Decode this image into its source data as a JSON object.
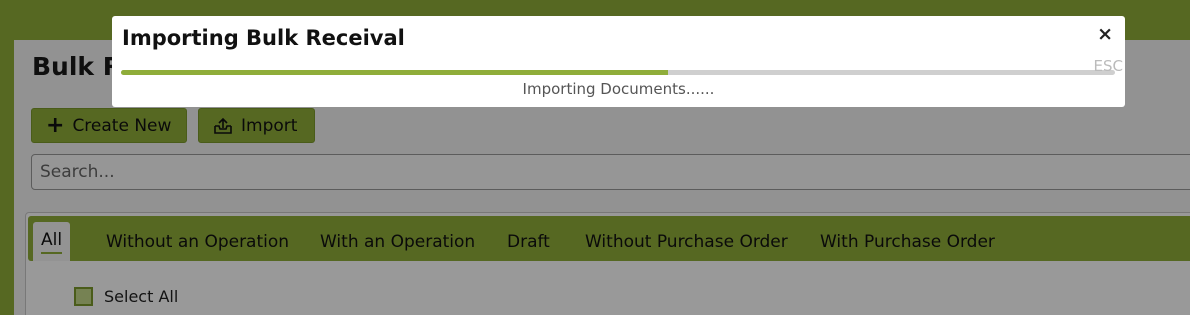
{
  "page": {
    "title": "Bulk R",
    "create_label": "Create New",
    "import_label": "Import",
    "search_placeholder": "Search...",
    "tabs": [
      {
        "label": "All",
        "active": true
      },
      {
        "label": "Without an Operation",
        "active": false
      },
      {
        "label": "With an Operation",
        "active": false
      },
      {
        "label": "Draft",
        "active": false
      },
      {
        "label": "Without Purchase Order",
        "active": false
      },
      {
        "label": "With Purchase Order",
        "active": false
      }
    ],
    "select_all_label": "Select All"
  },
  "modal": {
    "title": "Importing Bulk Receival",
    "close_icon": "×",
    "esc_label": "ESC",
    "progress_fraction": 0.55,
    "progress_text": "Importing Documents......"
  },
  "colors": {
    "accent": "#8fad3a",
    "accent_dark": "#7c9a2c"
  },
  "icons": {
    "create": "plus-icon",
    "import": "upload-tray-icon",
    "close": "close-icon"
  }
}
